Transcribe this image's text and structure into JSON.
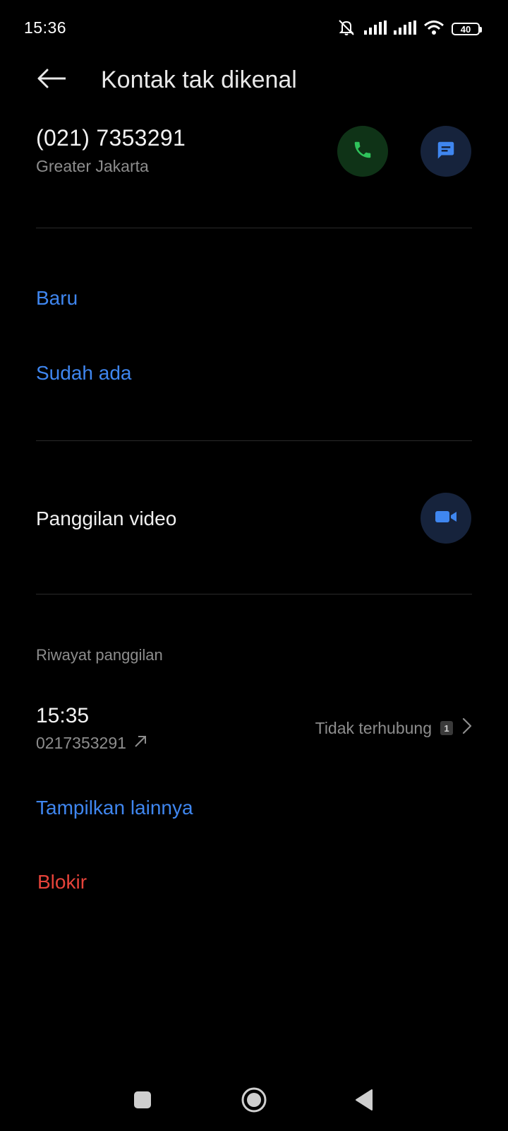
{
  "status_bar": {
    "time": "15:36",
    "battery": "40"
  },
  "header": {
    "title": "Kontak tak dikenal"
  },
  "contact": {
    "phone": "(021) 7353291",
    "location": "Greater Jakarta"
  },
  "add_contact": {
    "new_label": "Baru",
    "existing_label": "Sudah ada"
  },
  "video_call": {
    "label": "Panggilan video"
  },
  "history": {
    "section_label": "Riwayat panggilan",
    "items": [
      {
        "time": "15:35",
        "number": "0217353291",
        "status": "Tidak terhubung",
        "sim": "1"
      }
    ],
    "show_more_label": "Tampilkan lainnya"
  },
  "block": {
    "label": "Blokir"
  },
  "colors": {
    "accent_blue": "#3f86ef",
    "danger_red": "#e6433a",
    "call_green": "#2fc25b",
    "background": "#000000"
  },
  "icons": {
    "back": "arrow-left-icon",
    "call": "phone-icon",
    "message": "message-icon",
    "video": "video-camera-icon",
    "outgoing": "outgoing-arrow-icon",
    "chevron": "chevron-right-icon"
  }
}
